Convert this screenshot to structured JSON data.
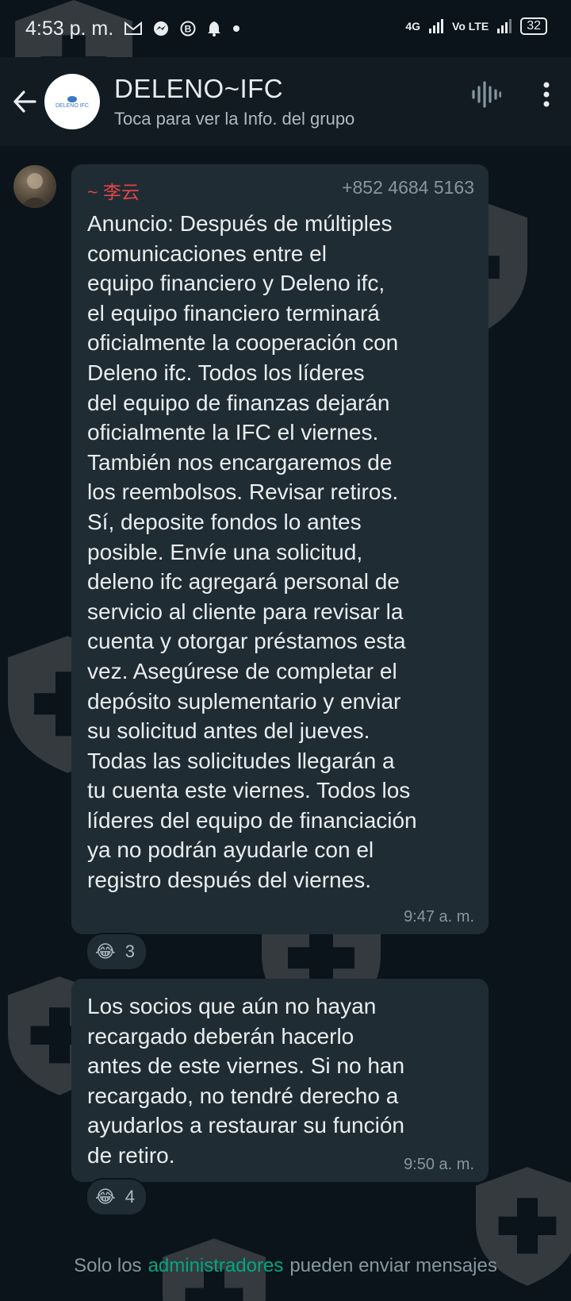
{
  "status_bar": {
    "time": "4:53 p. m.",
    "network_left": "4G",
    "network_right": "Vo LTE",
    "battery": "32",
    "icons": [
      "gmail-icon",
      "messenger-icon",
      "b-icon",
      "bell-icon",
      "dot-icon",
      "signal-icon",
      "signal-icon",
      "battery-icon"
    ]
  },
  "header": {
    "title": "DELENO~IFC",
    "subtitle": "Toca para ver la Info. del grupo",
    "avatar_text": "DELENO IFC",
    "actions": [
      "voice-chat-icon",
      "more-vert-icon"
    ]
  },
  "messages": [
    {
      "sender_name": "~ 李云",
      "sender_phone": "+852 4684 5163",
      "text": "Anuncio: Después de múltiples\ncomunicaciones entre el\nequipo financiero y Deleno ifc,\nel equipo financiero terminará\noficialmente la cooperación con\nDeleno ifc. Todos los líderes\ndel equipo de finanzas dejarán\noficialmente la IFC el viernes.\nTambién nos encargaremos de\nlos reembolsos. Revisar retiros.\nSí, deposite fondos lo antes\nposible. Envíe una solicitud,\ndeleno ifc agregará personal de\nservicio al cliente para revisar la\ncuenta y otorgar préstamos esta\nvez. Asegúrese de completar el\ndepósito suplementario y enviar\nsu solicitud antes del jueves.\nTodas las solicitudes llegarán a\ntu cuenta este viernes. Todos los\nlíderes del equipo de financiación\nya no podrán ayudarle con el\nregistro después del viernes.",
      "time": "9:47 a. m.",
      "reaction_emoji": "😂",
      "reaction_count": "3"
    },
    {
      "text": "Los socios que aún no hayan\nrecargado deberán hacerlo\nantes de este viernes. Si no han\nrecargado, no tendré derecho a\nayudarlos a restaurar su función\nde retiro.",
      "time": "9:50 a. m.",
      "reaction_emoji": "😂",
      "reaction_count": "4"
    }
  ],
  "footer": {
    "prefix": "Solo los",
    "link": "administradores",
    "suffix": "pueden enviar mensajes"
  },
  "colors": {
    "background": "#0b141a",
    "header": "#111b21",
    "bubble": "#202c33",
    "sender_name": "#e0454a",
    "accent_link": "#00a884"
  }
}
